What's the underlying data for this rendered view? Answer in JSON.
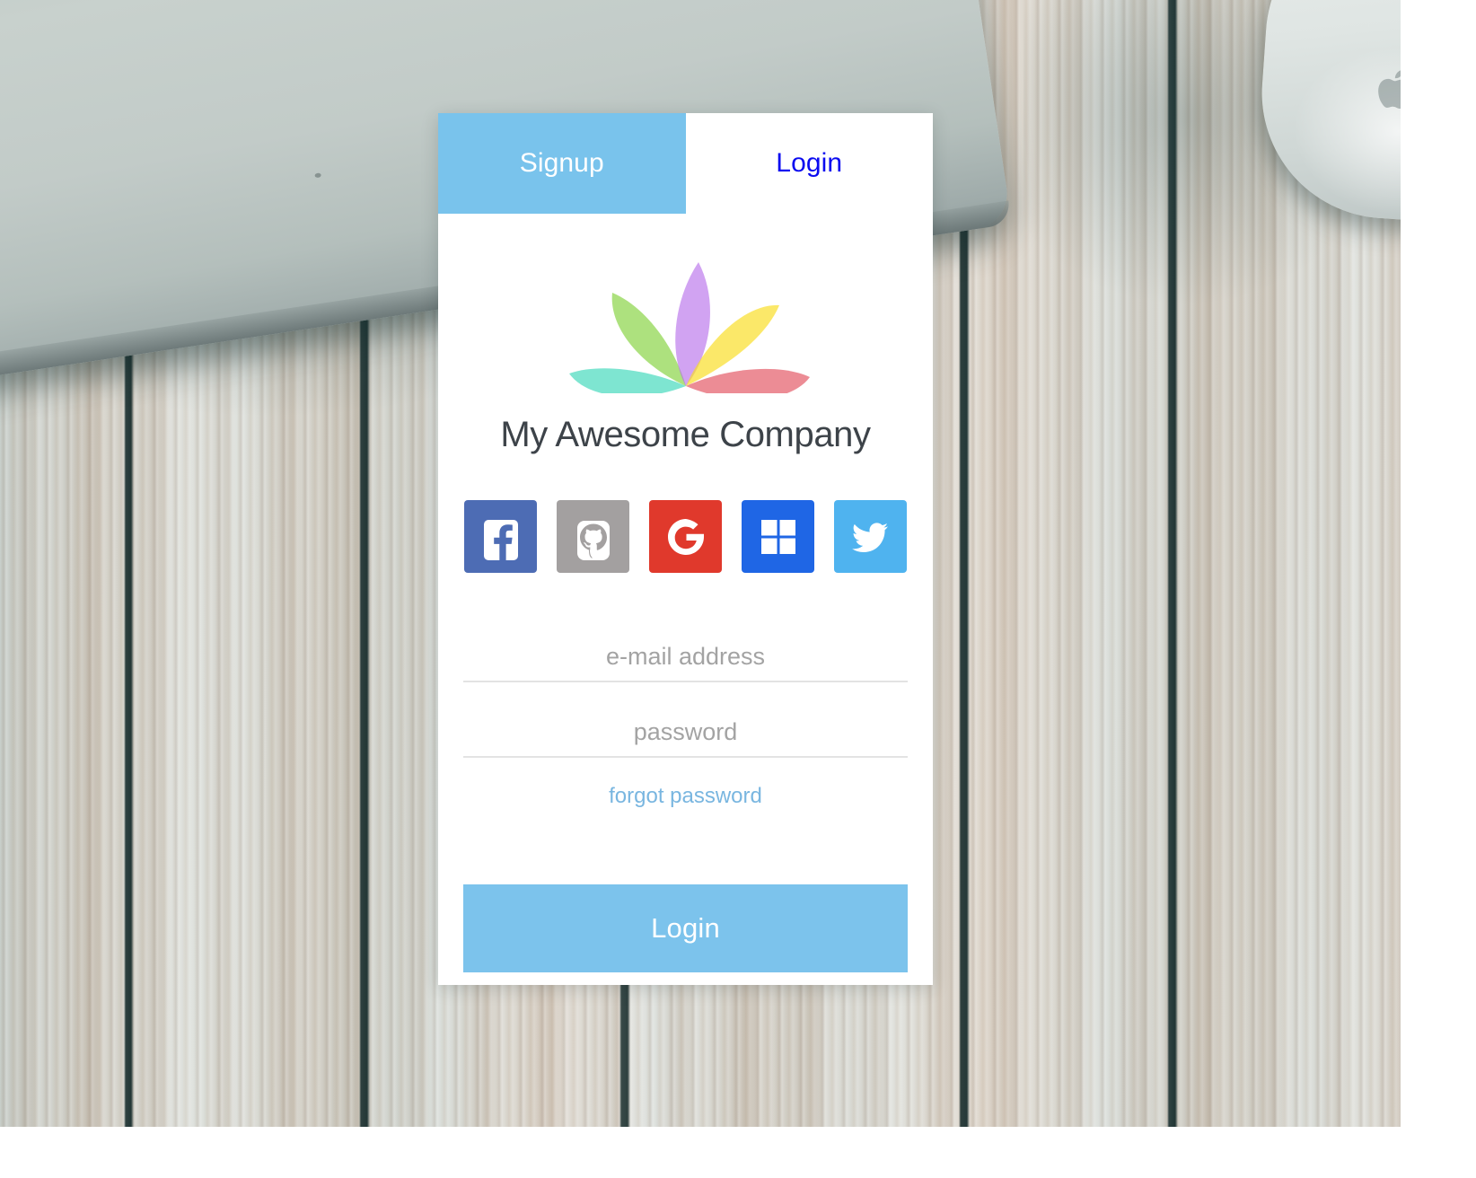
{
  "background": {
    "scene": "weathered whitewashed wood planks desk",
    "objects": [
      "macbook-laptop",
      "magic-mouse"
    ]
  },
  "card": {
    "tabs": [
      {
        "id": "signup",
        "label": "Signup",
        "active": true,
        "bg": "#79c3ec",
        "color": "#ffffff"
      },
      {
        "id": "login",
        "label": "Login",
        "active": false,
        "bg": "#ffffff",
        "color": "#0b0bf0"
      }
    ],
    "logo": {
      "icon": "lotus-flower-logo",
      "petals": [
        {
          "name": "teal-petal",
          "color": "#4fd8c0"
        },
        {
          "name": "green-petal",
          "color": "#8ed44f"
        },
        {
          "name": "purple-petal",
          "color": "#c98fea"
        },
        {
          "name": "yellow-petal",
          "color": "#fae24e"
        },
        {
          "name": "red-petal",
          "color": "#e2606a"
        }
      ]
    },
    "company_name": "My Awesome Company",
    "social_buttons": [
      {
        "id": "facebook",
        "label": "Facebook",
        "icon": "facebook-icon",
        "color": "#4d6cb4"
      },
      {
        "id": "github",
        "label": "GitHub",
        "icon": "github-icon",
        "color": "#a3a0a0"
      },
      {
        "id": "google",
        "label": "Google",
        "icon": "google-icon",
        "color": "#e0392c"
      },
      {
        "id": "microsoft",
        "label": "Microsoft",
        "icon": "microsoft-icon",
        "color": "#1f66e5"
      },
      {
        "id": "twitter",
        "label": "Twitter",
        "icon": "twitter-icon",
        "color": "#4fb3ef"
      }
    ],
    "form": {
      "email": {
        "value": "",
        "placeholder": "e-mail address"
      },
      "password": {
        "value": "",
        "placeholder": "password"
      },
      "forgot_password_label": "forgot password"
    },
    "submit": {
      "label": "Login",
      "color": "#7cc3ec"
    }
  }
}
